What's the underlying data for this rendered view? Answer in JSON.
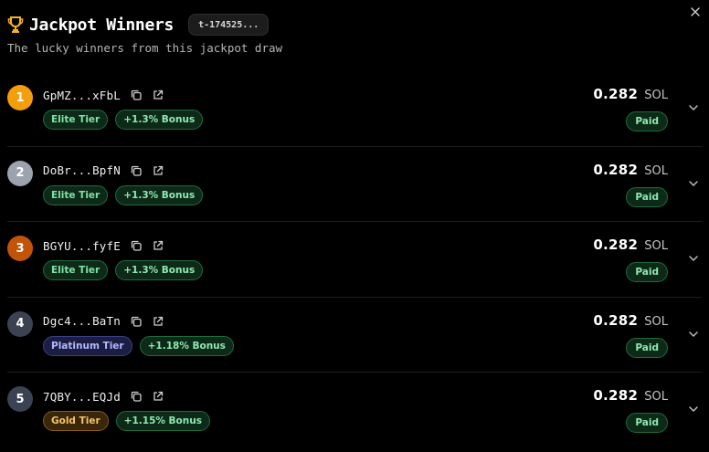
{
  "header": {
    "title": "Jackpot Winners",
    "draw_id": "t-174525...",
    "subtitle": "The lucky winners from this jackpot draw"
  },
  "icons": {
    "trophy": "trophy-icon",
    "close": "close-icon",
    "copy": "copy-icon",
    "external": "external-link-icon",
    "expand": "chevron-down-icon"
  },
  "colors": {
    "rank_gold": "#f59e0b",
    "rank_silver": "#9ca3af",
    "rank_bronze": "#c2540a",
    "rank_default": "#3b4252",
    "paid_green": "#8ee8b0"
  },
  "winners": [
    {
      "rank": "1",
      "address": "GpMZ...xFbL",
      "tier": "Elite Tier",
      "tier_class": "elite",
      "bonus": "+1.3% Bonus",
      "amount": "0.282",
      "currency": "SOL",
      "status": "Paid",
      "rank_color": "#f59e0b"
    },
    {
      "rank": "2",
      "address": "DoBr...BpfN",
      "tier": "Elite Tier",
      "tier_class": "elite",
      "bonus": "+1.3% Bonus",
      "amount": "0.282",
      "currency": "SOL",
      "status": "Paid",
      "rank_color": "#9ca3af"
    },
    {
      "rank": "3",
      "address": "BGYU...fyfE",
      "tier": "Elite Tier",
      "tier_class": "elite",
      "bonus": "+1.3% Bonus",
      "amount": "0.282",
      "currency": "SOL",
      "status": "Paid",
      "rank_color": "#c2540a"
    },
    {
      "rank": "4",
      "address": "Dgc4...BaTn",
      "tier": "Platinum Tier",
      "tier_class": "platinum",
      "bonus": "+1.18% Bonus",
      "amount": "0.282",
      "currency": "SOL",
      "status": "Paid",
      "rank_color": "#3b4252"
    },
    {
      "rank": "5",
      "address": "7QBY...EQJd",
      "tier": "Gold Tier",
      "tier_class": "gold",
      "bonus": "+1.15% Bonus",
      "amount": "0.282",
      "currency": "SOL",
      "status": "Paid",
      "rank_color": "#3b4252"
    }
  ]
}
